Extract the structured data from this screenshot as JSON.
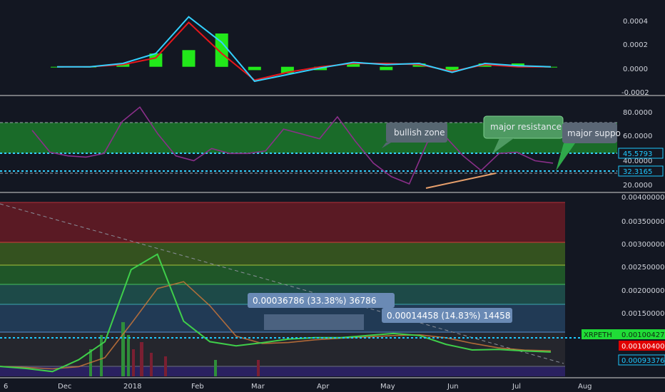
{
  "colors": {
    "background": "#131722",
    "divider": "#d7d7d7",
    "macd_line": "#33d1ff",
    "signal_line": "#e8161b",
    "histogram": "#22e81a",
    "rsi_line": "#8b2f8a",
    "rsi_zone": "#1c7a2a",
    "cyan_dashed": "#33d1ff",
    "trend_line": "#e8a06c",
    "label_bg": "#5a6675",
    "green_tag": "#20dc37",
    "red_tag": "#e10000",
    "cyan_tag": "#1ec9ff"
  },
  "macd_panel": {
    "ticks": [
      "0.0004",
      "0.0002",
      "0.0000",
      "-0.0002"
    ]
  },
  "rsi_panel": {
    "ticks": [
      "80.0000",
      "60.0000",
      "40.0000",
      "20.0000"
    ],
    "tags": [
      "45.5793",
      "32.3165"
    ],
    "callouts": [
      {
        "text": "bullish zone"
      },
      {
        "text": "major resistance"
      },
      {
        "text": "major suppo"
      }
    ]
  },
  "price_panel": {
    "ticks": [
      "0.00400000",
      "0.00350000",
      "0.00300000",
      "0.00250000",
      "0.00200000",
      "0.00150000"
    ],
    "symbol_tag": "XRPETH",
    "price_tags": [
      "0.00100427",
      "0.00100400",
      "0.00093376"
    ],
    "measurements": [
      {
        "text": "0.00036786 (33.38%) 36786"
      },
      {
        "text": "0.00014458 (14.83%) 14458"
      }
    ]
  },
  "time_axis": {
    "labels": [
      "6",
      "Dec",
      "2018",
      "Feb",
      "Mar",
      "Apr",
      "May",
      "Jun",
      "Jul",
      "Aug"
    ]
  },
  "chart_data": [
    {
      "type": "line",
      "title": "",
      "series": [
        {
          "values": [
            0.0,
            0.0,
            3e-05,
            0.00012,
            0.00045,
            0.00022,
            -0.00013,
            -7e-05,
            -1e-05,
            4e-05,
            2e-05,
            3e-05,
            -5e-05,
            3e-05,
            1e-05,
            0.0
          ]
        },
        {
          "values": [
            0.0,
            0.0,
            2e-05,
            8e-05,
            0.0004,
            0.00012,
            -0.00012,
            -5e-05,
            0.0,
            3e-05,
            3e-05,
            2e-05,
            -4e-05,
            2e-05,
            0.0,
            0.0
          ]
        }
      ],
      "ylim": [
        -0.00022,
        0.00055
      ]
    },
    {
      "type": "line",
      "title": "",
      "values": [
        63,
        45,
        42,
        41,
        44,
        70,
        82,
        60,
        42,
        38,
        48,
        44,
        44,
        46,
        64,
        60,
        56,
        74,
        54,
        36,
        25,
        19,
        53,
        58,
        42,
        30,
        44,
        45,
        38,
        36
      ],
      "ylim": [
        12,
        88
      ],
      "yticks": [
        80,
        60,
        40,
        20
      ]
    },
    {
      "type": "line",
      "title": "",
      "values": [
        0.00072,
        0.00068,
        0.00062,
        0.00085,
        0.0012,
        0.0026,
        0.0029,
        0.0016,
        0.0012,
        0.00112,
        0.00118,
        0.00125,
        0.00128,
        0.00128,
        0.00132,
        0.00136,
        0.00132,
        0.00115,
        0.00104,
        0.00105,
        0.00102,
        0.001
      ],
      "ylim": [
        0.0005,
        0.0041
      ],
      "yticks": [
        0.004,
        0.0035,
        0.003,
        0.0025,
        0.002,
        0.0015
      ]
    }
  ]
}
